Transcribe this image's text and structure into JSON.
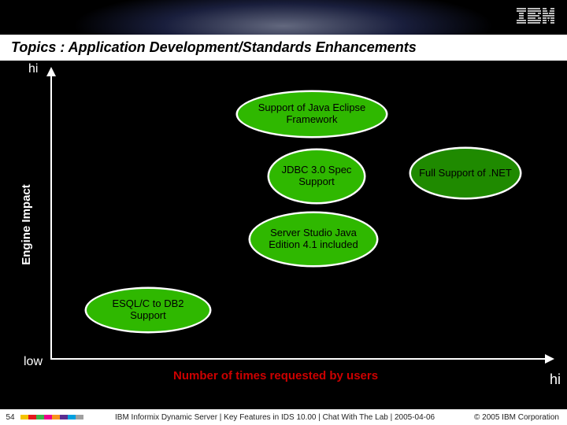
{
  "header": {
    "logo_text": "IBM"
  },
  "title": "Topics : Application Development/Standards  Enhancements",
  "chart": {
    "y_label": "Engine Impact",
    "x_label": "Number of times requested by users",
    "hi_top": "hi",
    "low": "low",
    "hi_right": "hi"
  },
  "bubbles": {
    "java": "Support of Java Eclipse Framework",
    "jdbc": "JDBC 3.0 Spec Support",
    "net": "Full Support of .NET",
    "studio": "Server Studio Java Edition 4.1 included",
    "esql": "ESQL/C to DB2 Support"
  },
  "footer": {
    "slide": "54",
    "text": "IBM Informix Dynamic Server | Key Features in IDS 10.00  |  Chat With The Lab  |  2005-04-06",
    "copyright": "© 2005 IBM Corporation",
    "colors": [
      "#f4c400",
      "#e41a1c",
      "#39b54a",
      "#ec008c",
      "#f7941d",
      "#5b2d90",
      "#00a0df",
      "#a0a0a0"
    ]
  },
  "chart_data": {
    "type": "scatter",
    "title": "Topics : Application Development/Standards Enhancements",
    "xlabel": "Number of times requested by users",
    "ylabel": "Engine Impact",
    "xlim": [
      0,
      10
    ],
    "ylim": [
      0,
      10
    ],
    "series": [
      {
        "name": "Support of Java Eclipse Framework",
        "x": 5.5,
        "y": 9.0
      },
      {
        "name": "JDBC 3.0 Spec Support",
        "x": 5.5,
        "y": 7.0
      },
      {
        "name": "Full Support of .NET",
        "x": 8.5,
        "y": 7.0
      },
      {
        "name": "Server Studio Java Edition 4.1 included",
        "x": 5.5,
        "y": 5.0
      },
      {
        "name": "ESQL/C to DB2 Support",
        "x": 2.0,
        "y": 2.5
      }
    ],
    "axis_notes": "Axes are qualitative: low→hi on both; numeric scale estimated 0–10."
  }
}
